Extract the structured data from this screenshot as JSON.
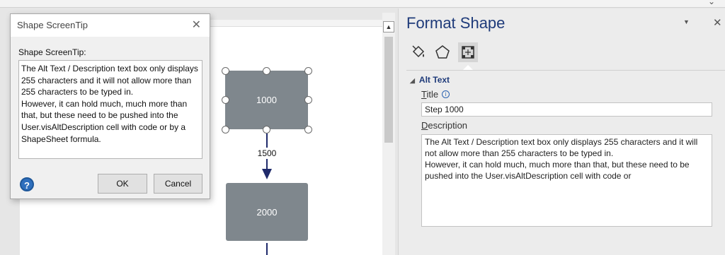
{
  "ribbon": {
    "collapse_glyph": "⌄"
  },
  "canvas": {
    "scroll_up_glyph": "▲",
    "shape_top_label": "1000",
    "shape_bottom_label": "2000",
    "connector_label": "1500"
  },
  "dialog": {
    "title": "Shape ScreenTip",
    "close_glyph": "✕",
    "field_label": "Shape ScreenTip:",
    "text": "The Alt Text / Description text box only displays 255 characters and it will not allow more than 255 characters to be typed in.\nHowever, it can hold much, much more than that, but these need to be pushed into the User.visAltDescription cell with code or by a ShapeSheet formula.",
    "help_glyph": "?",
    "ok_label": "OK",
    "cancel_label": "Cancel"
  },
  "pane": {
    "title": "Format Shape",
    "dropdown_glyph": "▼",
    "close_glyph": "✕",
    "tabs": [
      {
        "icon": "fill-bucket-icon"
      },
      {
        "icon": "pentagon-icon"
      },
      {
        "icon": "size-properties-icon",
        "active": true
      }
    ],
    "section_glyph": "◢",
    "section_title": "Alt Text",
    "title_label_first": "T",
    "title_label_rest": "itle",
    "title_info_glyph": "i",
    "title_value": "Step 1000",
    "description_label_first": "D",
    "description_label_rest": "escription",
    "description_value": "The Alt Text / Description text box only displays 255 characters and it will not allow more than 255 characters to be typed in.\nHowever, it can hold much, much more than that, but these need to be pushed into the User.visAltDescription cell with code or"
  },
  "colors": {
    "accent": "#1f3b7a",
    "shape_fill": "#7f878d",
    "connector": "#1f2a6b",
    "help_button": "#2f6fbd"
  }
}
